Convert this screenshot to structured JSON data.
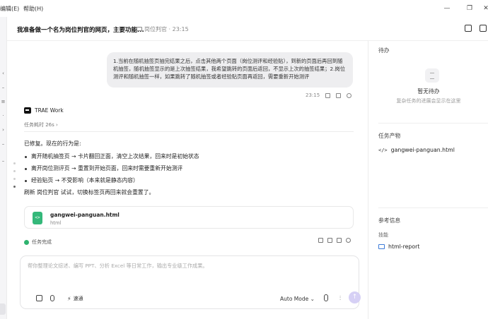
{
  "menu": {
    "edit": "编辑(E)",
    "help": "帮助(H)"
  },
  "window_controls": {
    "minimize": "—",
    "maximize": "❐",
    "close": "✕"
  },
  "header": {
    "title": "我准备做一个名为岗位判官的网页，主要功能...",
    "project": "岗位判官 · 23:15"
  },
  "user_message": {
    "text": "1.当前在随机抽签页抽完结果之后，点击其他两个页面（岗位测评和经验贴），到新的页面后再回到随机抽签，随机抽签显示的是上次抽签结果，我希望跳转的页面后返回，不显示上次的抽签结果；2.岗位测评和随机抽签一样，如果跳转了随机抽签或者经验贴页面再返回，需要重新开始测评",
    "time": "23:15"
  },
  "agent": {
    "name": "TRAE Work",
    "elapsed": "任务耗时 26s ›",
    "intro": "已修复。现在的行为是:",
    "bullets": [
      "离开随机抽签页 → 卡片翻回正面，清空上次结果，回来时是初始状态",
      "离开岗位测评页 → 重置到开始页面，回来时需要重新开始测评",
      "经验贴页 → 不受影响（本来就是静态内容）"
    ],
    "outro": "刷新 岗位判官 试试，切换标签页再回来就会重置了。",
    "file": {
      "name": "gangwei-panguan.html",
      "type": "html",
      "icon_text": "<>"
    },
    "status": "任务完成"
  },
  "composer": {
    "placeholder": "帮你整理论文综述、编写 PPT、分析 Excel 等日常工作，输出专业级工作成果。",
    "speed_label": "速通",
    "mode_label": "Auto Mode ⌄",
    "send_icon": "↑",
    "wave_icon": "⫶"
  },
  "panel": {
    "todo_title": "待办",
    "todo_empty": "暂无待办",
    "todo_hint": "复杂任务的进展会显示在这里",
    "artifacts_title": "任务产物",
    "artifact_name": "gangwei-panguan.html",
    "artifact_icon": "</>",
    "reference_title": "参考信息",
    "skills_label": "技能",
    "skill_name": "html-report"
  }
}
